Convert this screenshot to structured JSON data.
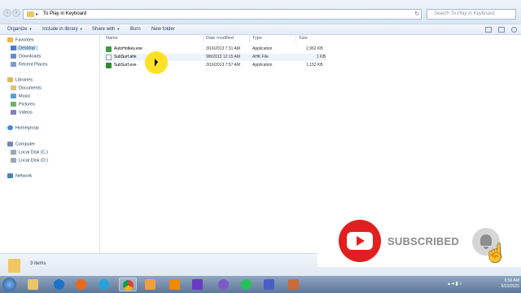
{
  "address": {
    "path": "To Play in Keyboard",
    "search_placeholder": "Search To Play in Keyboard"
  },
  "toolbar": {
    "organize": "Organize",
    "include_in_library": "Include in library",
    "share_with": "Share with",
    "burn": "Burn",
    "new_folder": "New folder"
  },
  "nav": {
    "favorites": "Favorites",
    "desktop": "Desktop",
    "downloads": "Downloads",
    "recent_places": "Recent Places",
    "libraries": "Libraries",
    "documents": "Documents",
    "music": "Music",
    "pictures": "Pictures",
    "videos": "Videos",
    "homegroup": "Homegroup",
    "computer": "Computer",
    "local_disk_c": "Local Disk (C:)",
    "local_disk_d": "Local Disk (D:)",
    "network": "Network"
  },
  "columns": {
    "name": "Name",
    "date_modified": "Date modified",
    "type": "Type",
    "size": "Size"
  },
  "files": [
    {
      "name": "AutoHotkey.exe",
      "date": "3/16/2013 7:31 AM",
      "type": "Application",
      "size": "2,962 KB",
      "icon": "autohotkey-icon"
    },
    {
      "name": "SubSurf.ahk",
      "date": "9/8/2013 12:15 AM",
      "type": "AHK File",
      "size": "1 KB",
      "icon": "ahk-file-icon"
    },
    {
      "name": "SubSurf.exe",
      "date": "3/16/2013 7:57 AM",
      "type": "Application",
      "size": "1,152 KB",
      "icon": "app-icon"
    }
  ],
  "status": {
    "item_count": "3 items"
  },
  "overlay": {
    "subscribed": "SUBSCRIBED"
  },
  "tray": {
    "time": "6:56 AM",
    "date": "6/23/2020"
  },
  "colors": {
    "youtube_red": "#e21f1f",
    "folder_yellow": "#f2c660",
    "cursor_highlight": "#ffdc00"
  }
}
